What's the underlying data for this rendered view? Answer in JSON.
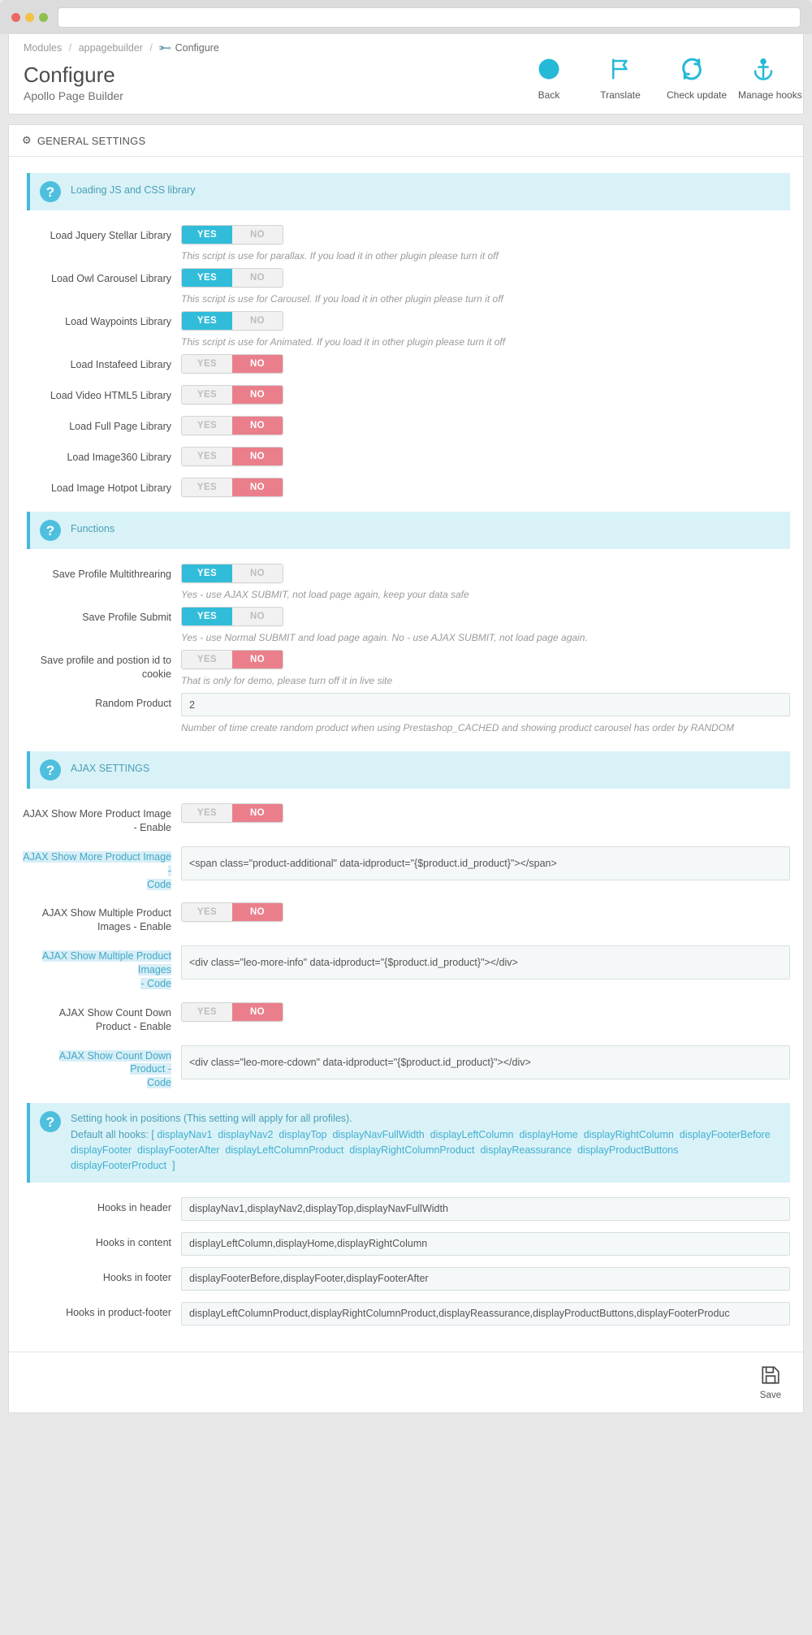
{
  "browser": {
    "url_value": ""
  },
  "breadcrumb": {
    "items": [
      "Modules",
      "appagebuilder"
    ],
    "current": "Configure"
  },
  "header": {
    "title": "Configure",
    "subtitle": "Apollo Page Builder",
    "actions": [
      {
        "label": "Back",
        "icon": "arrow-left-circle-icon"
      },
      {
        "label": "Translate",
        "icon": "flag-icon"
      },
      {
        "label": "Check update",
        "icon": "refresh-icon"
      },
      {
        "label": "Manage hooks",
        "icon": "anchor-icon"
      }
    ]
  },
  "panel": {
    "title": "GENERAL SETTINGS",
    "save_label": "Save"
  },
  "sections": {
    "library": {
      "info": "Loading JS and CSS library",
      "rows": [
        {
          "label": "Load Jquery Stellar Library",
          "value": "YES",
          "yes": "YES",
          "no": "NO",
          "help": "This script is use for parallax. If you load it in other plugin please turn it off"
        },
        {
          "label": "Load Owl Carousel Library",
          "value": "YES",
          "yes": "YES",
          "no": "NO",
          "help": "This script is use for Carousel. If you load it in other plugin please turn it off"
        },
        {
          "label": "Load Waypoints Library",
          "value": "YES",
          "yes": "YES",
          "no": "NO",
          "help": "This script is use for Animated. If you load it in other plugin please turn it off"
        },
        {
          "label": "Load Instafeed Library",
          "value": "NO",
          "yes": "YES",
          "no": "NO",
          "help": ""
        },
        {
          "label": "Load Video HTML5 Library",
          "value": "NO",
          "yes": "YES",
          "no": "NO",
          "help": ""
        },
        {
          "label": "Load Full Page Library",
          "value": "NO",
          "yes": "YES",
          "no": "NO",
          "help": ""
        },
        {
          "label": "Load Image360 Library",
          "value": "NO",
          "yes": "YES",
          "no": "NO",
          "help": ""
        },
        {
          "label": "Load Image Hotpot Library",
          "value": "NO",
          "yes": "YES",
          "no": "NO",
          "help": ""
        }
      ]
    },
    "functions": {
      "info": "Functions",
      "rows": [
        {
          "label": "Save Profile Multithrearing",
          "value": "YES",
          "yes": "YES",
          "no": "NO",
          "help": "Yes - use AJAX SUBMIT, not load page again, keep your data safe"
        },
        {
          "label": "Save Profile Submit",
          "value": "YES",
          "yes": "YES",
          "no": "NO",
          "help": "Yes - use Normal SUBMIT and load page again. No - use AJAX SUBMIT, not load page again."
        },
        {
          "label": "Save profile and postion id to cookie",
          "value": "NO",
          "yes": "YES",
          "no": "NO",
          "help": "That is only for demo, please turn off it in live site"
        }
      ],
      "random_product": {
        "label": "Random Product",
        "value": "2",
        "help": "Number of time create random product when using Prestashop_CACHED and showing product carousel has order by RANDOM"
      }
    },
    "ajax": {
      "info": "AJAX SETTINGS",
      "groups": [
        {
          "enable_label": "AJAX Show More Product Image - Enable",
          "enable_value": "NO",
          "code_label_main": "AJAX Show More Product Image -",
          "code_label_hl": "Code",
          "code_value": "<span class=\"product-additional\" data-idproduct=\"{$product.id_product}\"></span>"
        },
        {
          "enable_label": "AJAX Show Multiple Product Images - Enable",
          "enable_value": "NO",
          "code_label_main": "AJAX Show Multiple Product Images",
          "code_label_hl": "- Code",
          "code_value": "<div class=\"leo-more-info\" data-idproduct=\"{$product.id_product}\"></div>"
        },
        {
          "enable_label": "AJAX Show Count Down Product - Enable",
          "enable_value": "NO",
          "code_label_main": "AJAX Show Count Down Product -",
          "code_label_hl": "Code",
          "code_value": "<div class=\"leo-more-cdown\" data-idproduct=\"{$product.id_product}\"></div>"
        }
      ],
      "yes": "YES",
      "no": "NO"
    },
    "hooks": {
      "info_line1": "Setting hook in positions (This setting will apply for all profiles).",
      "info_line2_prefix": "Default all hooks: [",
      "info_line2_suffix": "]",
      "hook_list": [
        "displayNav1",
        "displayNav2",
        "displayTop",
        "displayNavFullWidth",
        "displayLeftColumn",
        "displayHome",
        "displayRightColumn",
        "displayFooterBefore",
        "displayFooter",
        "displayFooterAfter",
        "displayLeftColumnProduct",
        "displayRightColumnProduct",
        "displayReassurance",
        "displayProductButtons",
        "displayFooterProduct"
      ],
      "fields": [
        {
          "label": "Hooks in header",
          "value": "displayNav1,displayNav2,displayTop,displayNavFullWidth"
        },
        {
          "label": "Hooks in content",
          "value": "displayLeftColumn,displayHome,displayRightColumn"
        },
        {
          "label": "Hooks in footer",
          "value": "displayFooterBefore,displayFooter,displayFooterAfter"
        },
        {
          "label": "Hooks in product-footer",
          "value": "displayLeftColumnProduct,displayRightColumnProduct,displayReassurance,displayProductButtons,displayFooterProduc"
        }
      ]
    }
  },
  "colors": {
    "accent": "#31bcda",
    "danger": "#ea7f8b",
    "info_bg": "#d9f2f8",
    "info_text": "#4a9fb5"
  }
}
